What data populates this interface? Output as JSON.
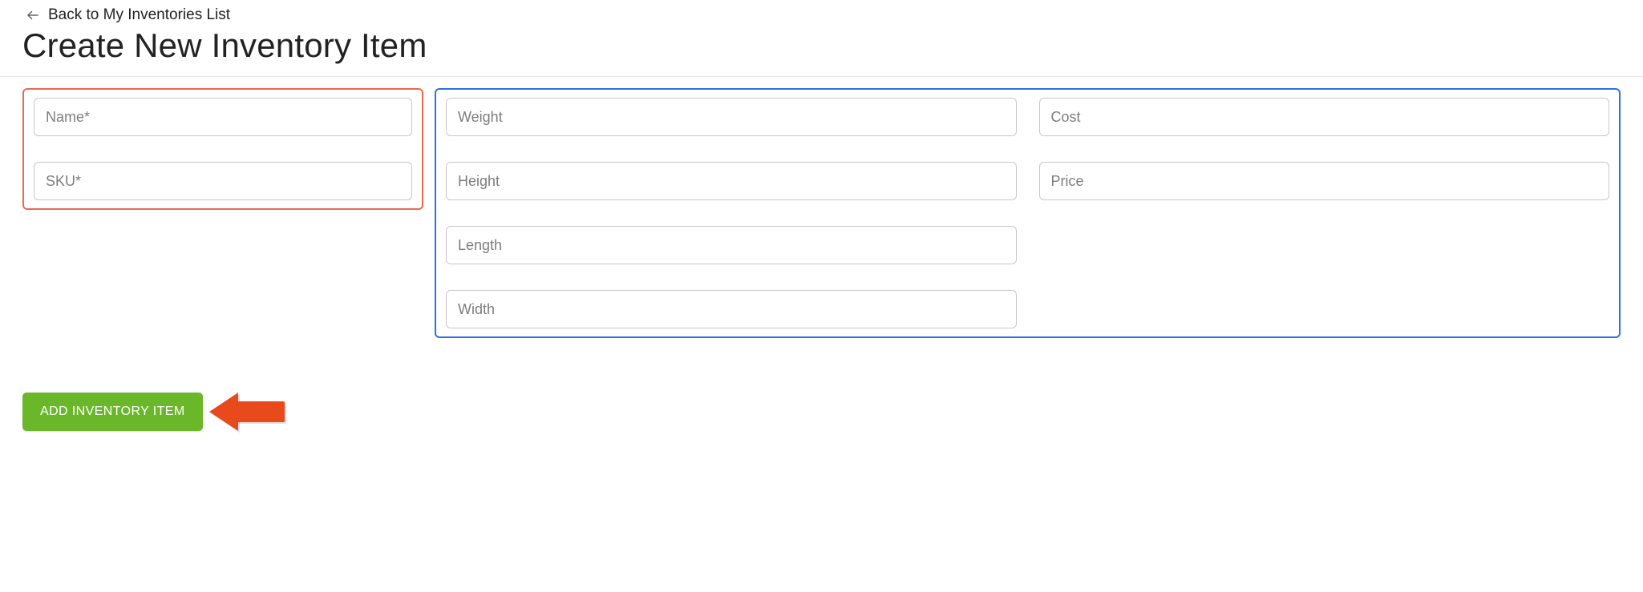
{
  "nav": {
    "back_label": "Back to My Inventories List"
  },
  "header": {
    "title": "Create New Inventory Item"
  },
  "form": {
    "required": {
      "name_placeholder": "Name*",
      "sku_placeholder": "SKU*"
    },
    "optional": {
      "weight_placeholder": "Weight",
      "height_placeholder": "Height",
      "length_placeholder": "Length",
      "width_placeholder": "Width",
      "cost_placeholder": "Cost",
      "price_placeholder": "Price"
    }
  },
  "actions": {
    "add_label": "ADD INVENTORY ITEM"
  },
  "colors": {
    "required_box_border": "#e96b4d",
    "optional_box_border": "#2f6fe3",
    "primary_button": "#6ab72a",
    "callout_arrow": "#e94a1b"
  }
}
